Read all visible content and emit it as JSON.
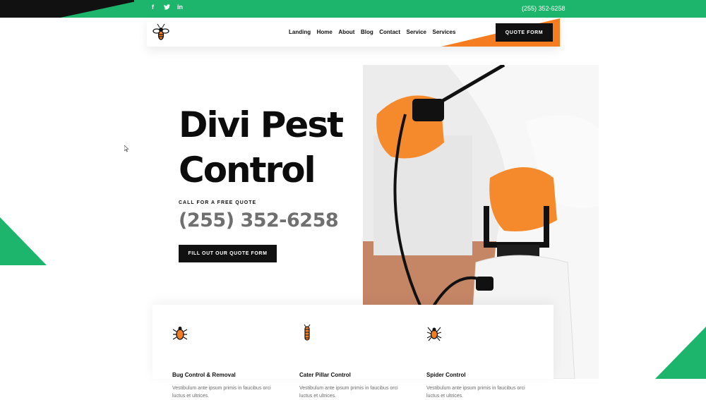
{
  "topbar": {
    "social": [
      {
        "name": "facebook-icon",
        "glyph": "f"
      },
      {
        "name": "twitter-icon",
        "glyph": "🐦"
      },
      {
        "name": "linkedin-icon",
        "glyph": "in"
      }
    ],
    "phone": "(255) 352-6258",
    "accent_color": "#1db56b"
  },
  "nav": {
    "logo_icon": "wasp-logo-icon",
    "items": [
      {
        "label": "Landing"
      },
      {
        "label": "Home"
      },
      {
        "label": "About"
      },
      {
        "label": "Blog"
      },
      {
        "label": "Contact"
      },
      {
        "label": "Service"
      },
      {
        "label": "Services"
      }
    ],
    "quote_button": "QUOTE FORM",
    "accent_color": "#f57d1f"
  },
  "hero": {
    "title_line1": "Divi Pest",
    "title_line2": "Control",
    "cta_label": "CALL FOR A FREE QUOTE",
    "phone": "(255) 352-6258",
    "button_label": "FILL OUT OUR QUOTE FORM",
    "image_icon": "pest-sprayer-photo"
  },
  "services": [
    {
      "icon": "bug-icon",
      "title": "Bug Control & Removal",
      "desc": "Vestibulum ante ipsum primis in faucibus orci luctus et ultrices."
    },
    {
      "icon": "caterpillar-icon",
      "title": "Cater Pillar Control",
      "desc": "Vestibulum ante ipsum primis in faucibus orci luctus et ultrices."
    },
    {
      "icon": "spider-icon",
      "title": "Spider Control",
      "desc": "Vestibulum ante ipsum primis in faucibus orci luctus et ultrices."
    }
  ]
}
